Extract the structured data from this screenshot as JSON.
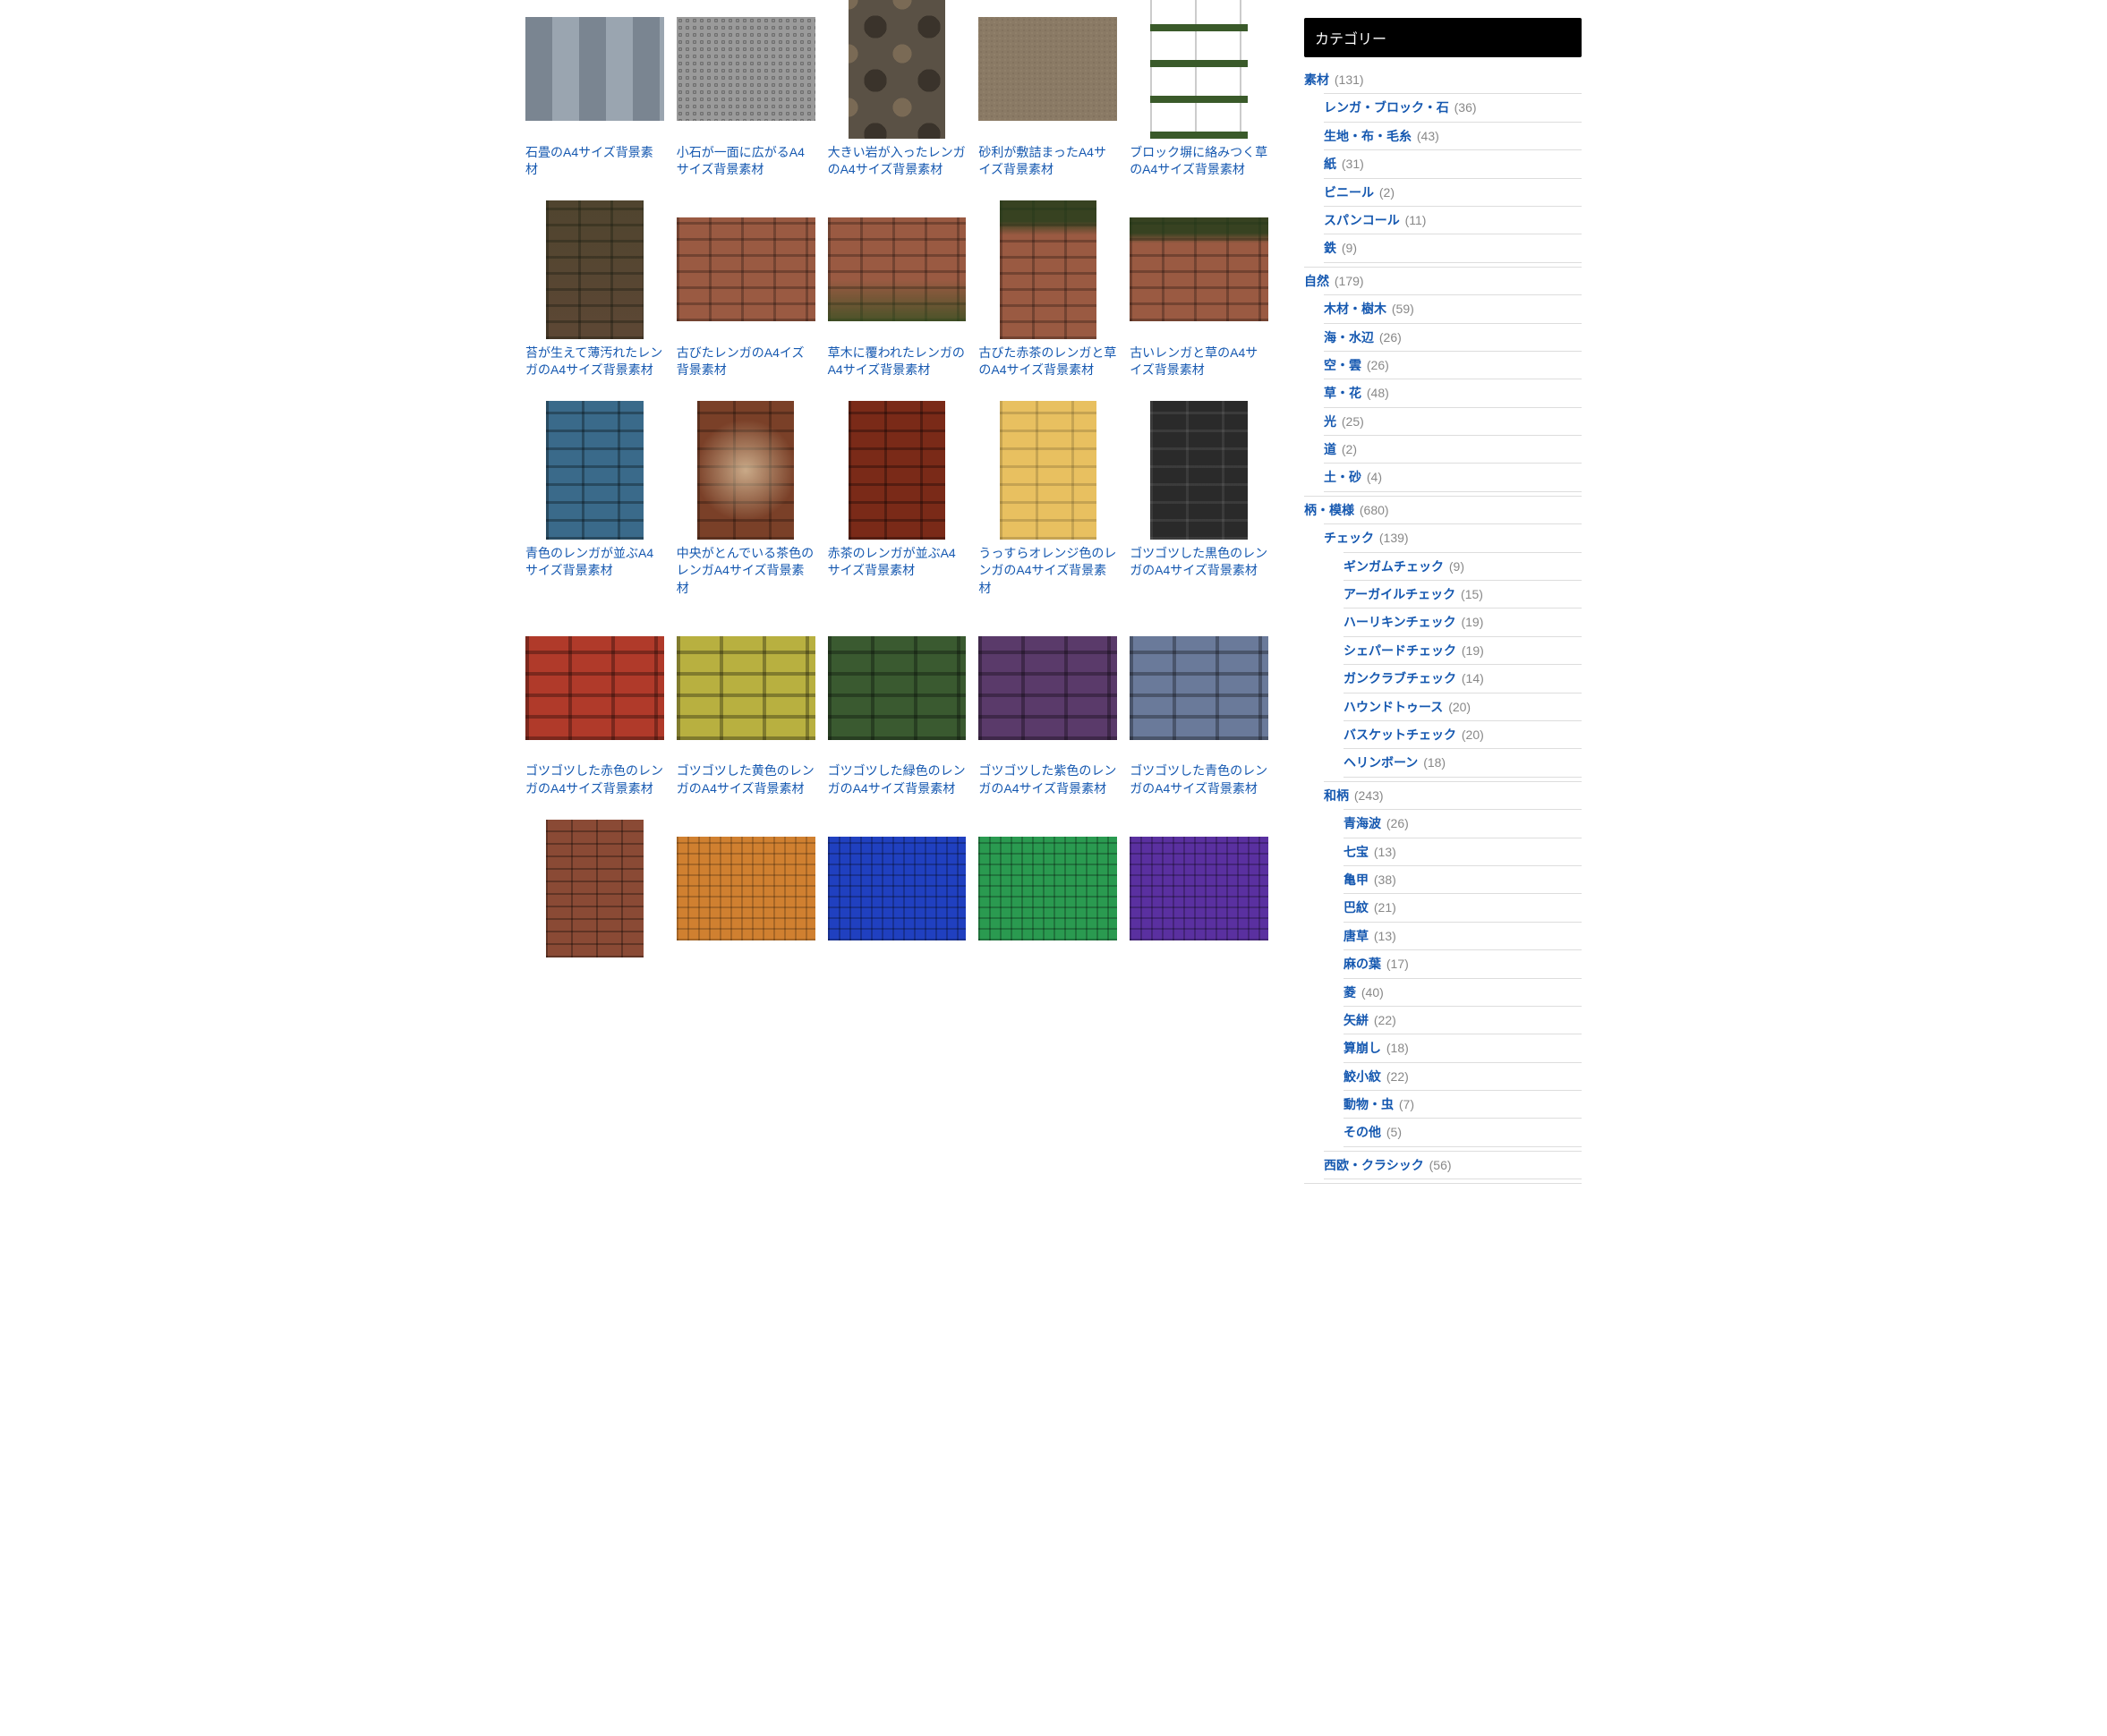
{
  "grid": {
    "items": [
      {
        "title": "石畳のA4サイズ背景素材",
        "shape": "landscape",
        "tx": "tx-stone"
      },
      {
        "title": "小石が一面に広がるA4サイズ背景素材",
        "shape": "landscape",
        "tx": "tx-pebble"
      },
      {
        "title": "大きい岩が入ったレンガのA4サイズ背景素材",
        "shape": "portrait",
        "tx": "tx-bigrock"
      },
      {
        "title": "砂利が敷詰まったA4サイズ背景素材",
        "shape": "landscape",
        "tx": "tx-gravel"
      },
      {
        "title": "ブロック塀に絡みつく草のA4サイズ背景素材",
        "shape": "portrait",
        "tx": "tx-blockgrass"
      },
      {
        "title": "苔が生えて薄汚れたレンガのA4サイズ背景素材",
        "shape": "portrait",
        "tx": "tx-brick-moss"
      },
      {
        "title": "古びたレンガのA4イズ背景素材",
        "shape": "landscape",
        "tx": "tx-brick-old"
      },
      {
        "title": "草木に覆われたレンガのA4サイズ背景素材",
        "shape": "landscape",
        "tx": "tx-brick-grass"
      },
      {
        "title": "古びた赤茶のレンガと草のA4サイズ背景素材",
        "shape": "portrait",
        "tx": "tx-brick-top"
      },
      {
        "title": "古いレンガと草のA4サイズ背景素材",
        "shape": "landscape",
        "tx": "tx-brick-top"
      },
      {
        "title": "青色のレンガが並ぶA4サイズ背景素材",
        "shape": "portrait",
        "tx": "tx-brick-blue"
      },
      {
        "title": "中央がとんでいる茶色のレンガA4サイズ背景素材",
        "shape": "portrait",
        "tx": "tx-brick-brown-glow"
      },
      {
        "title": "赤茶のレンガが並ぶA4サイズ背景素材",
        "shape": "portrait",
        "tx": "tx-brick-red"
      },
      {
        "title": "うっすらオレンジ色のレンガのA4サイズ背景素材",
        "shape": "portrait",
        "tx": "tx-brick-orange"
      },
      {
        "title": "ゴツゴツした黒色のレンガのA4サイズ背景素材",
        "shape": "portrait",
        "tx": "tx-brick-black"
      },
      {
        "title": "ゴツゴツした赤色のレンガのA4サイズ背景素材",
        "shape": "landscape",
        "tx": "tx-rough-red"
      },
      {
        "title": "ゴツゴツした黄色のレンガのA4サイズ背景素材",
        "shape": "landscape",
        "tx": "tx-rough-yellow"
      },
      {
        "title": "ゴツゴツした緑色のレンガのA4サイズ背景素材",
        "shape": "landscape",
        "tx": "tx-rough-green"
      },
      {
        "title": "ゴツゴツした紫色のレンガのA4サイズ背景素材",
        "shape": "landscape",
        "tx": "tx-rough-purple"
      },
      {
        "title": "ゴツゴツした青色のレンガのA4サイズ背景素材",
        "shape": "landscape",
        "tx": "tx-rough-blue"
      },
      {
        "title": "",
        "shape": "portrait",
        "tx": "tx-small-brick"
      },
      {
        "title": "",
        "shape": "landscape",
        "tx": "tx-tile-orange"
      },
      {
        "title": "",
        "shape": "landscape",
        "tx": "tx-tile-blue"
      },
      {
        "title": "",
        "shape": "landscape",
        "tx": "tx-tile-green"
      },
      {
        "title": "",
        "shape": "landscape",
        "tx": "tx-tile-purple"
      }
    ]
  },
  "sidebar": {
    "header": "カテゴリー",
    "categories": [
      {
        "label": "素材",
        "count": "(131)",
        "children": [
          {
            "label": "レンガ・ブロック・石",
            "count": "(36)"
          },
          {
            "label": "生地・布・毛糸",
            "count": "(43)"
          },
          {
            "label": "紙",
            "count": "(31)"
          },
          {
            "label": "ビニール",
            "count": "(2)"
          },
          {
            "label": "スパンコール",
            "count": "(11)"
          },
          {
            "label": "鉄",
            "count": "(9)"
          }
        ]
      },
      {
        "label": "自然",
        "count": "(179)",
        "children": [
          {
            "label": "木材・樹木",
            "count": "(59)"
          },
          {
            "label": "海・水辺",
            "count": "(26)"
          },
          {
            "label": "空・雲",
            "count": "(26)"
          },
          {
            "label": "草・花",
            "count": "(48)"
          },
          {
            "label": "光",
            "count": "(25)"
          },
          {
            "label": "道",
            "count": "(2)"
          },
          {
            "label": "土・砂",
            "count": "(4)"
          }
        ]
      },
      {
        "label": "柄・模様",
        "count": "(680)",
        "children": [
          {
            "label": "チェック",
            "count": "(139)",
            "children": [
              {
                "label": "ギンガムチェック",
                "count": "(9)"
              },
              {
                "label": "アーガイルチェック",
                "count": "(15)"
              },
              {
                "label": "ハーリキンチェック",
                "count": "(19)"
              },
              {
                "label": "シェパードチェック",
                "count": "(19)"
              },
              {
                "label": "ガンクラブチェック",
                "count": "(14)"
              },
              {
                "label": "ハウンドトゥース",
                "count": "(20)"
              },
              {
                "label": "バスケットチェック",
                "count": "(20)"
              },
              {
                "label": "ヘリンボーン",
                "count": "(18)"
              }
            ]
          },
          {
            "label": "和柄",
            "count": "(243)",
            "children": [
              {
                "label": "青海波",
                "count": "(26)"
              },
              {
                "label": "七宝",
                "count": "(13)"
              },
              {
                "label": "亀甲",
                "count": "(38)"
              },
              {
                "label": "巴紋",
                "count": "(21)"
              },
              {
                "label": "唐草",
                "count": "(13)"
              },
              {
                "label": "麻の葉",
                "count": "(17)"
              },
              {
                "label": "菱",
                "count": "(40)"
              },
              {
                "label": "矢絣",
                "count": "(22)"
              },
              {
                "label": "算崩し",
                "count": "(18)"
              },
              {
                "label": "鮫小紋",
                "count": "(22)"
              },
              {
                "label": "動物・虫",
                "count": "(7)"
              },
              {
                "label": "その他",
                "count": "(5)"
              }
            ]
          },
          {
            "label": "西欧・クラシック",
            "count": "(56)"
          }
        ]
      }
    ]
  }
}
